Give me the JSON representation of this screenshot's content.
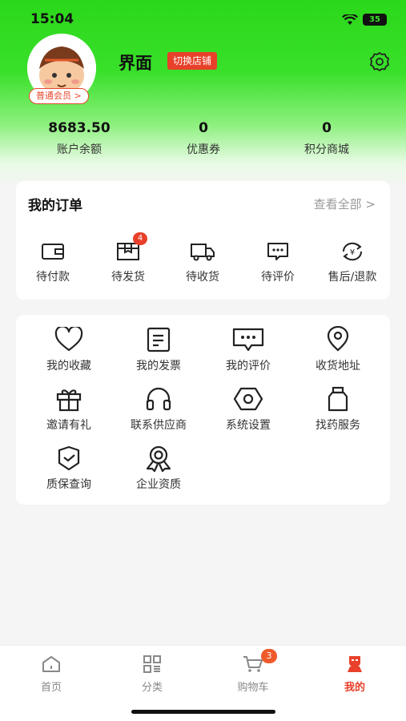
{
  "status_bar": {
    "time": "15:04",
    "battery": "35"
  },
  "profile": {
    "shop_name": "界面",
    "switch_shop_label": "切换店铺",
    "member_level": "普通会员 >"
  },
  "stats": [
    {
      "value": "8683.50",
      "label": "账户余额"
    },
    {
      "value": "0",
      "label": "优惠券"
    },
    {
      "value": "0",
      "label": "积分商城"
    }
  ],
  "orders": {
    "title": "我的订单",
    "view_all": "查看全部 >",
    "items": [
      {
        "label": "待付款",
        "icon": "wallet-icon",
        "badge": ""
      },
      {
        "label": "待发货",
        "icon": "package-icon",
        "badge": "4"
      },
      {
        "label": "待收货",
        "icon": "truck-icon",
        "badge": ""
      },
      {
        "label": "待评价",
        "icon": "comment-icon",
        "badge": ""
      },
      {
        "label": "售后/退款",
        "icon": "refund-icon",
        "badge": ""
      }
    ]
  },
  "services": [
    {
      "label": "我的收藏",
      "icon": "heart-icon"
    },
    {
      "label": "我的发票",
      "icon": "invoice-icon"
    },
    {
      "label": "我的评价",
      "icon": "review-icon"
    },
    {
      "label": "收货地址",
      "icon": "location-icon"
    },
    {
      "label": "邀请有礼",
      "icon": "gift-icon"
    },
    {
      "label": "联系供应商",
      "icon": "headset-icon"
    },
    {
      "label": "系统设置",
      "icon": "hex-settings-icon"
    },
    {
      "label": "找药服务",
      "icon": "medicine-bottle-icon"
    },
    {
      "label": "质保查询",
      "icon": "shield-icon"
    },
    {
      "label": "企业资质",
      "icon": "award-icon"
    }
  ],
  "tabbar": [
    {
      "label": "首页",
      "icon": "home-icon",
      "active": false
    },
    {
      "label": "分类",
      "icon": "category-icon",
      "active": false
    },
    {
      "label": "购物车",
      "icon": "cart-icon",
      "active": false,
      "badge": "3"
    },
    {
      "label": "我的",
      "icon": "profile-icon",
      "active": true
    }
  ],
  "colors": {
    "brand_green": "#2bd81a",
    "accent_red": "#e8402a"
  }
}
